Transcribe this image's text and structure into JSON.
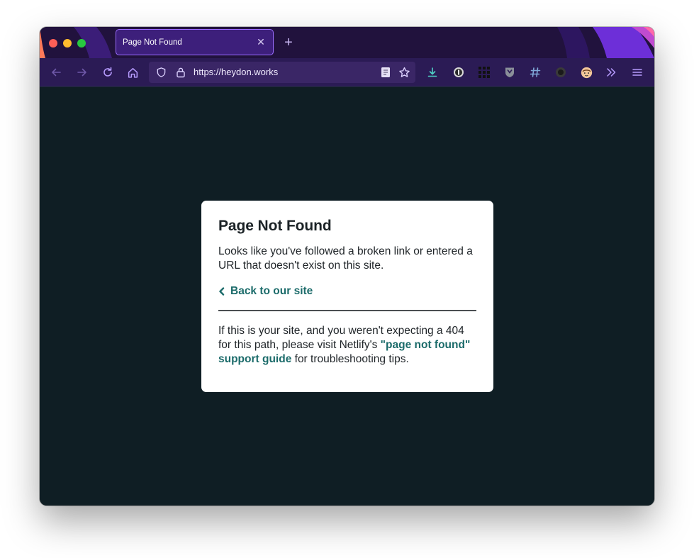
{
  "browser": {
    "tab": {
      "title": "Page Not Found",
      "close_glyph": "✕"
    },
    "new_tab_glyph": "+",
    "url": "https://heydon.works",
    "accent_color": "#9b6dff",
    "icons": [
      "back-arrow-icon",
      "forward-arrow-icon",
      "reload-icon",
      "home-icon",
      "shield-icon",
      "lock-icon",
      "reader-view-icon",
      "bookmark-star-icon",
      "downloads-icon",
      "password-manager-icon",
      "grid-extension-icon",
      "shield-extension-icon",
      "hash-extension-icon",
      "circle-extension-icon",
      "emoji-extension-icon",
      "overflow-chevrons-icon",
      "hamburger-menu-icon"
    ]
  },
  "page": {
    "background": "#0f1e24",
    "link_color": "#1b6b6a",
    "title": "Page Not Found",
    "description": "Looks like you've followed a broken link or entered a URL that doesn't exist on this site.",
    "back_link": "Back to our site",
    "help_prefix": "If this is your site, and you weren't expecting a 404 for this path, please visit Netlify's ",
    "help_link": "\"page not found\" support guide",
    "help_suffix": " for troubleshooting tips."
  }
}
